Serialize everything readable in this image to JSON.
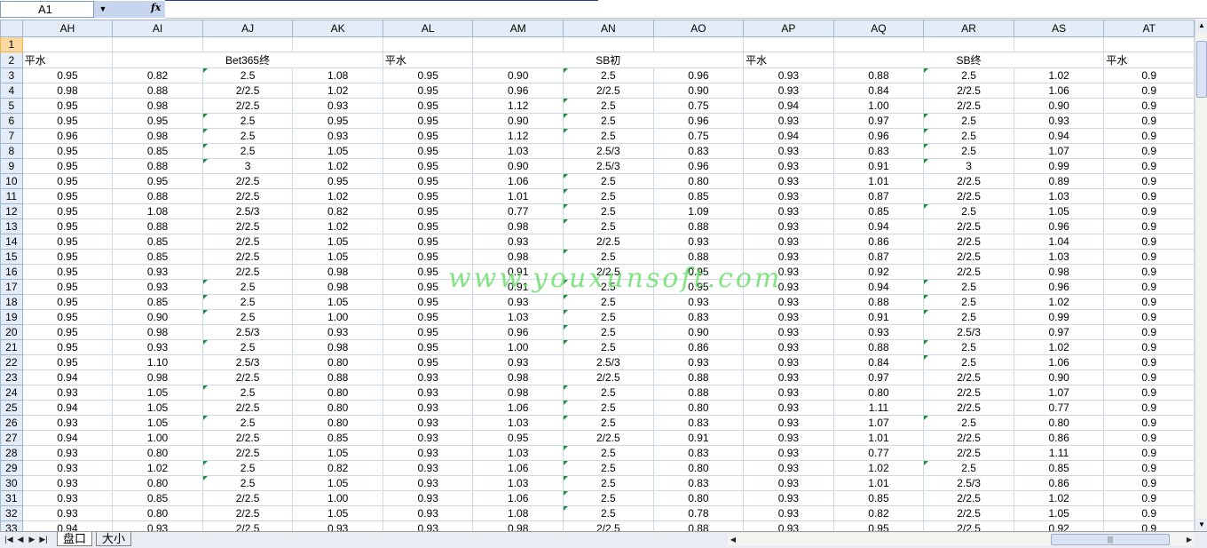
{
  "formula_bar": {
    "name_box": "A1",
    "fx_label": "fx"
  },
  "columns": [
    "AH",
    "AI",
    "AJ",
    "AK",
    "AL",
    "AM",
    "AN",
    "AO",
    "AP",
    "AQ",
    "AR",
    "AS",
    "AT"
  ],
  "header_row_2": [
    {
      "text": "平水",
      "align": "left",
      "span": 1
    },
    {
      "text": "Bet365终",
      "align": "center",
      "span": 3
    },
    {
      "text": "平水",
      "align": "left",
      "span": 1
    },
    {
      "text": "SB初",
      "align": "center",
      "span": 3
    },
    {
      "text": "平水",
      "align": "left",
      "span": 1
    },
    {
      "text": "SB终",
      "align": "center",
      "span": 3
    },
    {
      "text": "平水",
      "align": "left",
      "span": 1
    }
  ],
  "rows": [
    {
      "n": "3",
      "cells": [
        "0.95",
        "0.82",
        "2.5",
        "1.08",
        "0.95",
        "0.90",
        "2.5",
        "0.96",
        "0.93",
        "0.88",
        "2.5",
        "1.02",
        "0.9"
      ]
    },
    {
      "n": "4",
      "cells": [
        "0.98",
        "0.88",
        "2/2.5",
        "1.02",
        "0.95",
        "0.96",
        "2/2.5",
        "0.90",
        "0.93",
        "0.84",
        "2/2.5",
        "1.06",
        "0.9"
      ]
    },
    {
      "n": "5",
      "cells": [
        "0.95",
        "0.98",
        "2/2.5",
        "0.93",
        "0.95",
        "1.12",
        "2.5",
        "0.75",
        "0.94",
        "1.00",
        "2/2.5",
        "0.90",
        "0.9"
      ]
    },
    {
      "n": "6",
      "cells": [
        "0.95",
        "0.95",
        "2.5",
        "0.95",
        "0.95",
        "0.90",
        "2.5",
        "0.96",
        "0.93",
        "0.97",
        "2.5",
        "0.93",
        "0.9"
      ]
    },
    {
      "n": "7",
      "cells": [
        "0.96",
        "0.98",
        "2.5",
        "0.93",
        "0.95",
        "1.12",
        "2.5",
        "0.75",
        "0.94",
        "0.96",
        "2.5",
        "0.94",
        "0.9"
      ]
    },
    {
      "n": "8",
      "cells": [
        "0.95",
        "0.85",
        "2.5",
        "1.05",
        "0.95",
        "1.03",
        "2.5/3",
        "0.83",
        "0.93",
        "0.83",
        "2.5",
        "1.07",
        "0.9"
      ]
    },
    {
      "n": "9",
      "cells": [
        "0.95",
        "0.88",
        "3",
        "1.02",
        "0.95",
        "0.90",
        "2.5/3",
        "0.96",
        "0.93",
        "0.91",
        "3",
        "0.99",
        "0.9"
      ]
    },
    {
      "n": "10",
      "cells": [
        "0.95",
        "0.95",
        "2/2.5",
        "0.95",
        "0.95",
        "1.06",
        "2.5",
        "0.80",
        "0.93",
        "1.01",
        "2/2.5",
        "0.89",
        "0.9"
      ]
    },
    {
      "n": "11",
      "cells": [
        "0.95",
        "0.88",
        "2/2.5",
        "1.02",
        "0.95",
        "1.01",
        "2.5",
        "0.85",
        "0.93",
        "0.87",
        "2/2.5",
        "1.03",
        "0.9"
      ]
    },
    {
      "n": "12",
      "cells": [
        "0.95",
        "1.08",
        "2.5/3",
        "0.82",
        "0.95",
        "0.77",
        "2.5",
        "1.09",
        "0.93",
        "0.85",
        "2.5",
        "1.05",
        "0.9"
      ]
    },
    {
      "n": "13",
      "cells": [
        "0.95",
        "0.88",
        "2/2.5",
        "1.02",
        "0.95",
        "0.98",
        "2.5",
        "0.88",
        "0.93",
        "0.94",
        "2/2.5",
        "0.96",
        "0.9"
      ]
    },
    {
      "n": "14",
      "cells": [
        "0.95",
        "0.85",
        "2/2.5",
        "1.05",
        "0.95",
        "0.93",
        "2/2.5",
        "0.93",
        "0.93",
        "0.86",
        "2/2.5",
        "1.04",
        "0.9"
      ]
    },
    {
      "n": "15",
      "cells": [
        "0.95",
        "0.85",
        "2/2.5",
        "1.05",
        "0.95",
        "0.98",
        "2.5",
        "0.88",
        "0.93",
        "0.87",
        "2/2.5",
        "1.03",
        "0.9"
      ]
    },
    {
      "n": "16",
      "cells": [
        "0.95",
        "0.93",
        "2/2.5",
        "0.98",
        "0.95",
        "0.91",
        "2/2.5",
        "0.95",
        "0.93",
        "0.92",
        "2/2.5",
        "0.98",
        "0.9"
      ]
    },
    {
      "n": "17",
      "cells": [
        "0.95",
        "0.93",
        "2.5",
        "0.98",
        "0.95",
        "0.91",
        "2.5",
        "0.95",
        "0.93",
        "0.94",
        "2.5",
        "0.96",
        "0.9"
      ]
    },
    {
      "n": "18",
      "cells": [
        "0.95",
        "0.85",
        "2.5",
        "1.05",
        "0.95",
        "0.93",
        "2.5",
        "0.93",
        "0.93",
        "0.88",
        "2.5",
        "1.02",
        "0.9"
      ]
    },
    {
      "n": "19",
      "cells": [
        "0.95",
        "0.90",
        "2.5",
        "1.00",
        "0.95",
        "1.03",
        "2.5",
        "0.83",
        "0.93",
        "0.91",
        "2.5",
        "0.99",
        "0.9"
      ]
    },
    {
      "n": "20",
      "cells": [
        "0.95",
        "0.98",
        "2.5/3",
        "0.93",
        "0.95",
        "0.96",
        "2.5",
        "0.90",
        "0.93",
        "0.93",
        "2.5/3",
        "0.97",
        "0.9"
      ]
    },
    {
      "n": "21",
      "cells": [
        "0.95",
        "0.93",
        "2.5",
        "0.98",
        "0.95",
        "1.00",
        "2.5",
        "0.86",
        "0.93",
        "0.88",
        "2.5",
        "1.02",
        "0.9"
      ]
    },
    {
      "n": "22",
      "cells": [
        "0.95",
        "1.10",
        "2.5/3",
        "0.80",
        "0.95",
        "0.93",
        "2.5/3",
        "0.93",
        "0.93",
        "0.84",
        "2.5",
        "1.06",
        "0.9"
      ]
    },
    {
      "n": "23",
      "cells": [
        "0.94",
        "0.98",
        "2/2.5",
        "0.88",
        "0.93",
        "0.98",
        "2/2.5",
        "0.88",
        "0.93",
        "0.97",
        "2/2.5",
        "0.90",
        "0.9"
      ]
    },
    {
      "n": "24",
      "cells": [
        "0.93",
        "1.05",
        "2.5",
        "0.80",
        "0.93",
        "0.98",
        "2.5",
        "0.88",
        "0.93",
        "0.80",
        "2/2.5",
        "1.07",
        "0.9"
      ]
    },
    {
      "n": "25",
      "cells": [
        "0.94",
        "1.05",
        "2/2.5",
        "0.80",
        "0.93",
        "1.06",
        "2.5",
        "0.80",
        "0.93",
        "1.11",
        "2/2.5",
        "0.77",
        "0.9"
      ]
    },
    {
      "n": "26",
      "cells": [
        "0.93",
        "1.05",
        "2.5",
        "0.80",
        "0.93",
        "1.03",
        "2.5",
        "0.83",
        "0.93",
        "1.07",
        "2.5",
        "0.80",
        "0.9"
      ]
    },
    {
      "n": "27",
      "cells": [
        "0.94",
        "1.00",
        "2/2.5",
        "0.85",
        "0.93",
        "0.95",
        "2/2.5",
        "0.91",
        "0.93",
        "1.01",
        "2/2.5",
        "0.86",
        "0.9"
      ]
    },
    {
      "n": "28",
      "cells": [
        "0.93",
        "0.80",
        "2/2.5",
        "1.05",
        "0.93",
        "1.03",
        "2.5",
        "0.83",
        "0.93",
        "0.77",
        "2/2.5",
        "1.11",
        "0.9"
      ]
    },
    {
      "n": "29",
      "cells": [
        "0.93",
        "1.02",
        "2.5",
        "0.82",
        "0.93",
        "1.06",
        "2.5",
        "0.80",
        "0.93",
        "1.02",
        "2.5",
        "0.85",
        "0.9"
      ]
    },
    {
      "n": "30",
      "cells": [
        "0.93",
        "0.80",
        "2.5",
        "1.05",
        "0.93",
        "1.03",
        "2.5",
        "0.83",
        "0.93",
        "1.01",
        "2.5/3",
        "0.86",
        "0.9"
      ]
    },
    {
      "n": "31",
      "cells": [
        "0.93",
        "0.85",
        "2/2.5",
        "1.00",
        "0.93",
        "1.06",
        "2.5",
        "0.80",
        "0.93",
        "0.85",
        "2/2.5",
        "1.02",
        "0.9"
      ]
    },
    {
      "n": "32",
      "cells": [
        "0.93",
        "0.80",
        "2/2.5",
        "1.05",
        "0.93",
        "1.08",
        "2.5",
        "0.78",
        "0.93",
        "0.82",
        "2/2.5",
        "1.05",
        "0.9"
      ]
    },
    {
      "n": "33",
      "cells": [
        "0.94",
        "0.93",
        "2/2.5",
        "0.93",
        "0.93",
        "0.98",
        "2/2.5",
        "0.88",
        "0.93",
        "0.95",
        "2/2.5",
        "0.92",
        "0.9"
      ]
    }
  ],
  "sheet_tabs": [
    {
      "label": "盘口"
    },
    {
      "label": "大小"
    }
  ],
  "tab_nav_icons": [
    "first-sheet-icon",
    "prev-sheet-icon",
    "next-sheet-icon",
    "last-sheet-icon"
  ],
  "watermark": "www.youxunsoft.com",
  "colors": {
    "header_bg": "#e4ecf7",
    "selected_row_header": "#f9d99f",
    "comment_marker": "#1e8f3a",
    "watermark": "#6ee06e"
  }
}
